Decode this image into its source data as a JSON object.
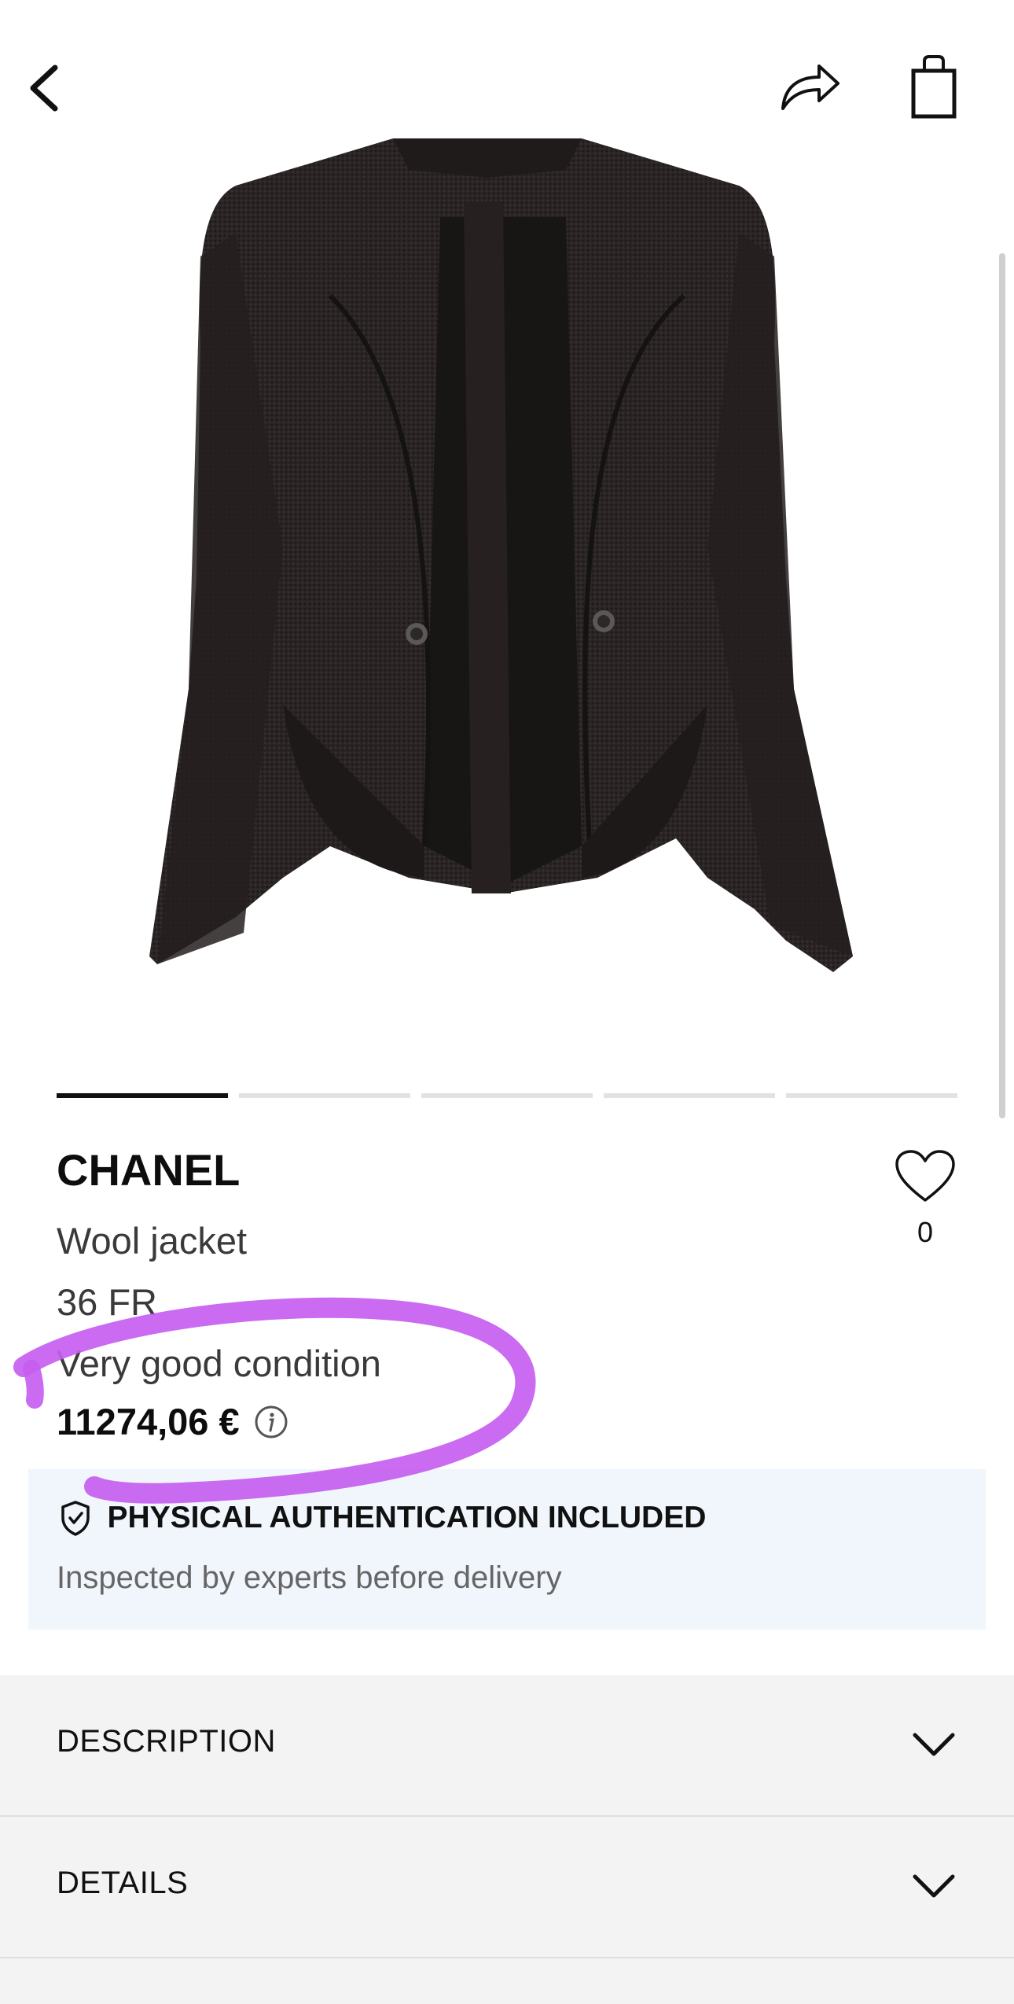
{
  "header": {
    "back_icon": "chevron-left-icon",
    "share_icon": "share-arrow-icon",
    "bag_icon": "shopping-bag-icon"
  },
  "gallery": {
    "image_count": 5,
    "active_index": 0
  },
  "product": {
    "brand": "CHANEL",
    "name": "Wool jacket",
    "size": "36 FR",
    "condition": "Very good condition",
    "price": "11274,06 €",
    "favorites_count": "0"
  },
  "authentication": {
    "title": "PHYSICAL AUTHENTICATION INCLUDED",
    "subtitle": "Inspected by experts before delivery"
  },
  "sections": [
    {
      "label": "DESCRIPTION"
    },
    {
      "label": "DETAILS"
    }
  ],
  "colors": {
    "annotation_stroke": "#c65ef0",
    "auth_background": "#f1f6fc",
    "accordion_background": "#f3f3f3"
  }
}
